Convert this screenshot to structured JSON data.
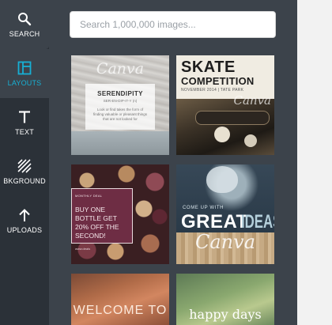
{
  "sidebar": {
    "items": [
      {
        "label": "SEARCH",
        "icon": "search-icon"
      },
      {
        "label": "LAYOUTS",
        "icon": "layouts-icon",
        "active": true
      },
      {
        "label": "TEXT",
        "icon": "text-icon"
      },
      {
        "label": "BKGROUND",
        "icon": "background-icon"
      },
      {
        "label": "UPLOADS",
        "icon": "uploads-icon"
      }
    ],
    "active_color": "#17b0d4",
    "background": "#2b3138"
  },
  "search": {
    "placeholder": "Search 1,000,000 images..."
  },
  "layouts": [
    {
      "name": "serendipity",
      "watermark": "Canva",
      "title": "SERENDIPITY",
      "subtitle": "SER-EN-DIP-IT-Y (n)",
      "body": "Look or find takes the form of finding valuable or pleasant things that are not looked for"
    },
    {
      "name": "skate-competition",
      "line1": "SKATE",
      "line2": "COMPETITION",
      "date": "NOVEMBER 2014 | TATE PARK",
      "watermark": "Canva"
    },
    {
      "name": "wine-offer",
      "small": "MONTHLY DEAL",
      "offer": "BUY ONE BOTTLE GET 20% OFF THE SECOND!",
      "footer": "www.deals"
    },
    {
      "name": "great-ideas",
      "small": "COME UP WITH",
      "great": "GREAT",
      "ideas": "IDEAS",
      "watermark": "Canva"
    },
    {
      "name": "welcome",
      "text": "WELCOME TO"
    },
    {
      "name": "happy-days",
      "text": "happy days"
    }
  ]
}
